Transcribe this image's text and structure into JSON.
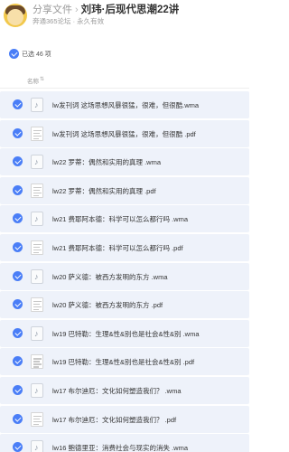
{
  "header": {
    "breadcrumb_root": "分享文件",
    "breadcrumb_sep": "›",
    "title": "刘玮·后现代思潮22讲",
    "subtitle": "奔通365论坛 · 永久有效"
  },
  "selection": {
    "text": "已选 46 项"
  },
  "list": {
    "column_name": "名称",
    "sort_icon": "sort-arrows-icon",
    "items": [
      {
        "name": "lw发刊词 这场思想风暴很猛，很难，但很酷.wma",
        "type": "audio"
      },
      {
        "name": "lw发刊词 这场思想风暴很猛，很难，但很酷 .pdf",
        "type": "pdf"
      },
      {
        "name": "lw22 罗蒂：偶然和实用的真理 .wma",
        "type": "audio"
      },
      {
        "name": "lw22 罗蒂：偶然和实用的真理 .pdf",
        "type": "pdf"
      },
      {
        "name": "lw21 费耶阿本德：科学可以怎么都行吗 .wma",
        "type": "audio"
      },
      {
        "name": "lw21 费耶阿本德：科学可以怎么都行吗 .pdf",
        "type": "pdf"
      },
      {
        "name": "lw20 萨义德：被西方发明的东方 .wma",
        "type": "audio"
      },
      {
        "name": "lw20 萨义德：被西方发明的东方 .pdf",
        "type": "pdf"
      },
      {
        "name": "lw19 巴特勒：生理&性&别也是社会&性&别 .wma",
        "type": "audio"
      },
      {
        "name": "lw19 巴特勒：生理&性&别也是社会&性&别 .pdf",
        "type": "pdf"
      },
      {
        "name": "lw17 布尔迪厄：文化如何塑造我们？ .wma",
        "type": "audio"
      },
      {
        "name": "lw17 布尔迪厄：文化如何塑造我们？ .pdf",
        "type": "pdf"
      },
      {
        "name": "lw16 鲍德里亚：消费社会与现实的消失 .wma",
        "type": "audio"
      }
    ]
  },
  "colors": {
    "accent": "#4a7ef7",
    "row_selected_bg": "#eef2fa"
  }
}
